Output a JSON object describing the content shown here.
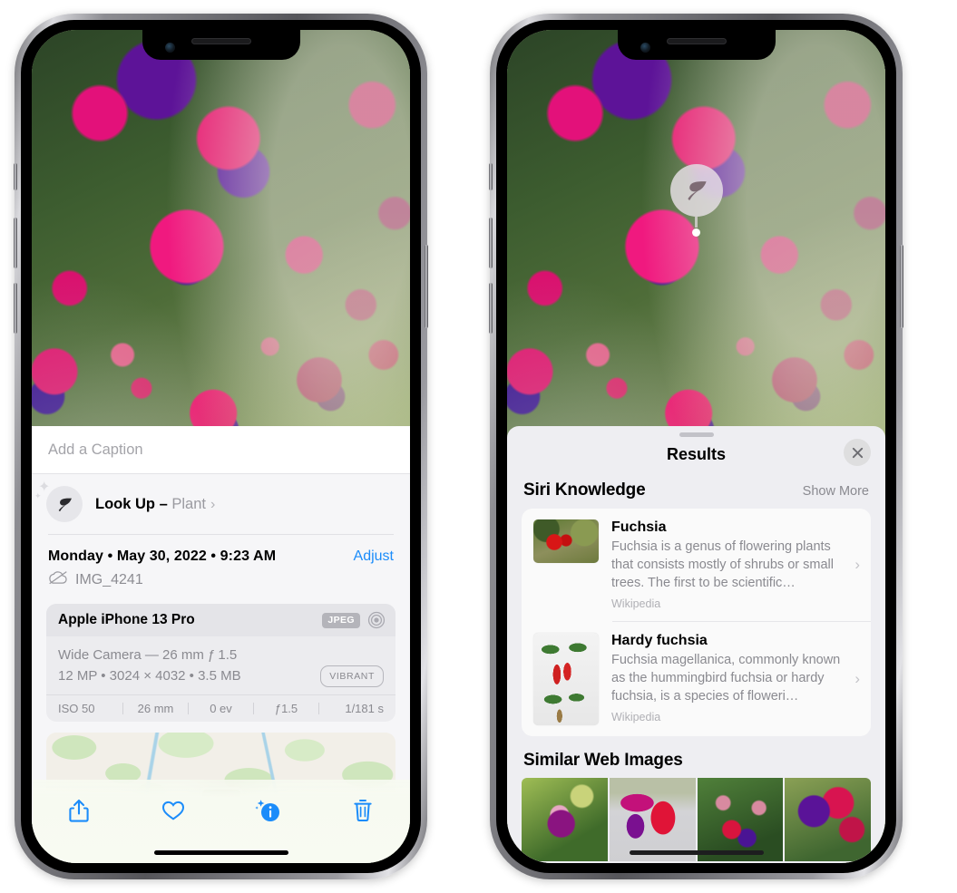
{
  "left_phone": {
    "caption": {
      "placeholder": "Add a Caption",
      "value": ""
    },
    "lookup": {
      "label": "Look Up – ",
      "subject": "Plant",
      "chevron": "›",
      "icon": "leaf-icon"
    },
    "info": {
      "date": "Monday • May 30, 2022 • 9:23 AM",
      "adjust_label": "Adjust",
      "filename": "IMG_4241",
      "cloud_icon": "cloud-slash-icon"
    },
    "camera": {
      "model": "Apple iPhone 13 Pro",
      "format_badge": "JPEG",
      "depth_icon": "depth-effect-icon",
      "lens": "Wide Camera — 26 mm ƒ 1.5",
      "specs": "12 MP •  3024 × 4032 •  3.5 MB",
      "style_badge": "VIBRANT",
      "exif": [
        "ISO 50",
        "26 mm",
        "0 ev",
        "ƒ1.5",
        "1/181 s"
      ]
    },
    "toolbar": [
      {
        "name": "share-button",
        "icon": "share-icon"
      },
      {
        "name": "favorite-button",
        "icon": "heart-icon"
      },
      {
        "name": "info-button",
        "icon": "info-sparkle-icon"
      },
      {
        "name": "delete-button",
        "icon": "trash-icon"
      }
    ],
    "accent_color": "#1b8cfa"
  },
  "right_phone": {
    "visual_lookup_badge": {
      "icon": "leaf-icon"
    },
    "sheet": {
      "title": "Results",
      "close_icon": "close-icon",
      "siri_knowledge": {
        "title": "Siri Knowledge",
        "show_more": "Show More",
        "items": [
          {
            "title": "Fuchsia",
            "description": "Fuchsia is a genus of flowering plants that consists mostly of shrubs or small trees. The first to be scientific…",
            "source": "Wikipedia",
            "chevron": "›"
          },
          {
            "title": "Hardy fuchsia",
            "description": "Fuchsia magellanica, commonly known as the hummingbird fuchsia or hardy fuchsia, is a species of floweri…",
            "source": "Wikipedia",
            "chevron": "›"
          }
        ]
      },
      "similar_web_images": {
        "title": "Similar Web Images",
        "count": 4
      }
    }
  }
}
